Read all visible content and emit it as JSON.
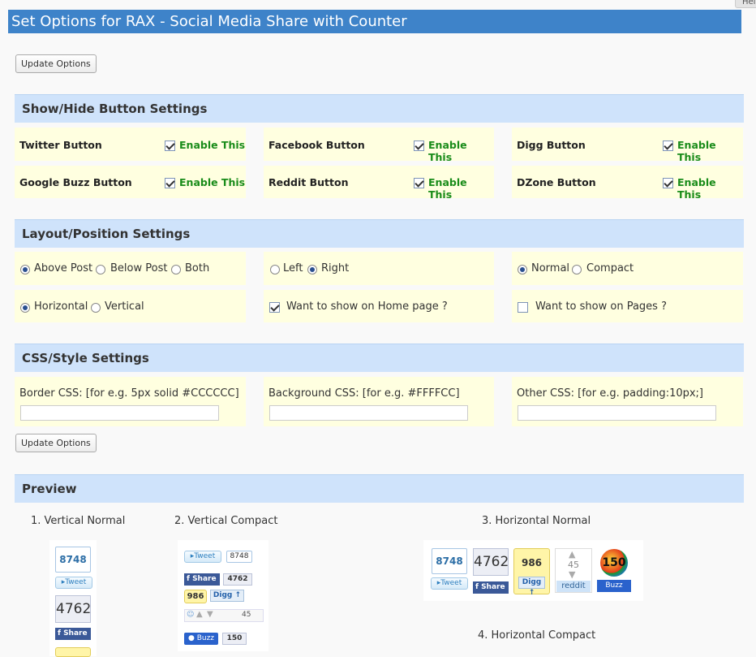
{
  "help_tab": "Help",
  "title": "Set Options for RAX - Social Media Share with Counter",
  "buttons": {
    "update_top": "Update Options",
    "update_bottom": "Update Options"
  },
  "sections": {
    "show_hide": "Show/Hide Button Settings",
    "layout": "Layout/Position Settings",
    "css": "CSS/Style Settings",
    "preview": "Preview"
  },
  "show_hide": {
    "enable_label": "Enable This",
    "items": [
      {
        "label": "Twitter Button",
        "checked": true
      },
      {
        "label": "Facebook Button",
        "checked": true
      },
      {
        "label": "Digg Button",
        "checked": true
      },
      {
        "label": "Google Buzz Button",
        "checked": true
      },
      {
        "label": "Reddit Button",
        "checked": true
      },
      {
        "label": "DZone Button",
        "checked": true
      }
    ]
  },
  "layout": {
    "position": {
      "options": [
        "Above Post",
        "Below Post",
        "Both"
      ],
      "selected": "Above Post"
    },
    "align": {
      "options": [
        "Left",
        "Right"
      ],
      "selected": "Right"
    },
    "size": {
      "options": [
        "Normal",
        "Compact"
      ],
      "selected": "Normal"
    },
    "orientation": {
      "options": [
        "Horizontal",
        "Vertical"
      ],
      "selected": "Horizontal"
    },
    "home_page": {
      "label": "Want to show on Home page ?",
      "checked": true
    },
    "pages": {
      "label": "Want to show on Pages ?",
      "checked": false
    }
  },
  "css": {
    "border_label": "Border CSS: [for e.g. 5px solid #CCCCCC]",
    "border_value": "",
    "background_label": "Background CSS: [for e.g. #FFFFCC]",
    "background_value": "",
    "other_label": "Other CSS: [for e.g. padding:10px;]",
    "other_value": ""
  },
  "preview": {
    "labels": [
      "1. Vertical Normal",
      "2. Vertical Compact",
      "3. Horizontal Normal",
      "4. Horizontal Compact"
    ],
    "twitter_count": "8748",
    "twitter_label": "Tweet",
    "facebook_count": "4762",
    "facebook_label": "Share",
    "digg_count": "986",
    "digg_label": "Digg",
    "reddit_count": "45",
    "reddit_label": "reddit",
    "buzz_count": "150",
    "buzz_label": "Buzz"
  },
  "colors": {
    "title_bar": "#3e83c9",
    "section_head": "#cfe3fb",
    "cell_bg": "#ffffe0",
    "enable_green": "#1a8c1a"
  }
}
